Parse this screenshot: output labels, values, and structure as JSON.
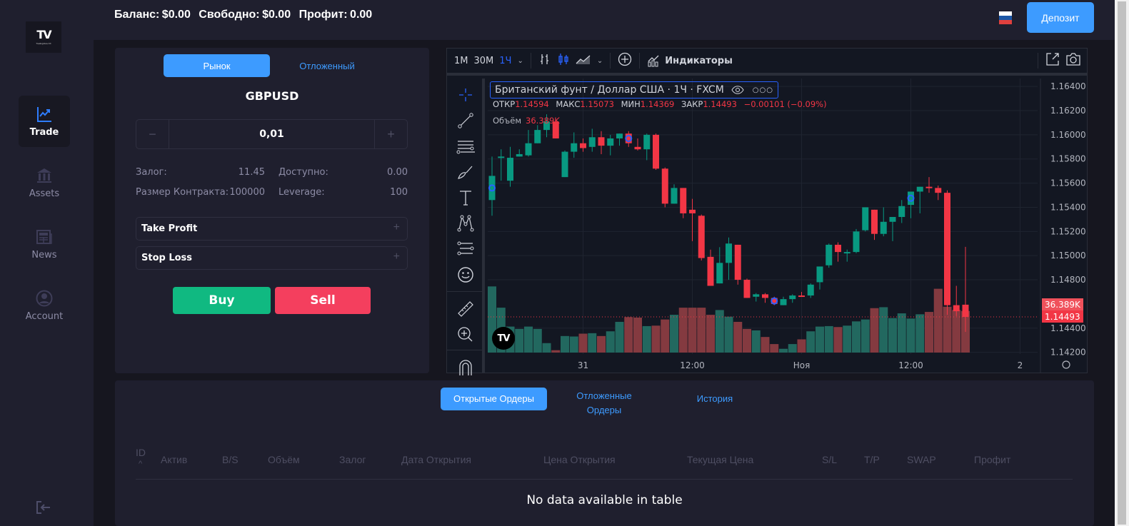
{
  "header": {
    "balance_label": "Баланс: $0.00",
    "free_label": "Свободно: $0.00",
    "profit_label": "Профит: 0.00",
    "language_flag": "russia-flag",
    "deposit_label": "Депозит"
  },
  "sidebar": {
    "logo_text": "TV",
    "logo_sub": "TradingView FX",
    "items": [
      {
        "label": "Trade",
        "icon": "chart-line-icon",
        "active": true
      },
      {
        "label": "Assets",
        "icon": "bank-icon",
        "active": false
      },
      {
        "label": "News",
        "icon": "newspaper-icon",
        "active": false
      },
      {
        "label": "Account",
        "icon": "user-circle-icon",
        "active": false
      }
    ],
    "logout_icon": "logout-icon"
  },
  "order_panel": {
    "tabs": [
      {
        "label": "Рынок",
        "active": true
      },
      {
        "label": "Отложенный",
        "active": false
      }
    ],
    "symbol": "GBPUSD",
    "volume": "0,01",
    "minus": "−",
    "plus": "+",
    "info": [
      {
        "label": "Залог:",
        "value": "11.45",
        "label2": "Доступно:",
        "value2": "0.00"
      },
      {
        "label": "Размер Контракта:",
        "value": "100000",
        "label2": "Leverage:",
        "value2": "100"
      }
    ],
    "take_profit": "Take Profit",
    "stop_loss": "Stop Loss",
    "buy_label": "Buy",
    "sell_label": "Sell"
  },
  "chart": {
    "toolbar": {
      "intervals": [
        "1M",
        "30M",
        "1Ч"
      ],
      "active_interval": "1Ч",
      "indicators_label": "Индикаторы"
    },
    "legend": {
      "title": "Британский фунт / Доллар США · 1Ч · FXCM",
      "open_label": "ОТКР",
      "open": "1.14594",
      "high_label": "МАКС",
      "high": "1.15073",
      "low_label": "МИН",
      "low": "1.14369",
      "close_label": "ЗАКР",
      "close": "1.14493",
      "change": "−0.00101 (−0.09%)",
      "volume_label": "Объём",
      "volume": "36.389K"
    },
    "price_badge": "1.14493",
    "volume_badge": "36.389K",
    "colors": {
      "up": "#089981",
      "down": "#f23645",
      "up_vol": "#22685f",
      "down_vol": "#843a40",
      "accent": "#2962ff"
    }
  },
  "chart_data": {
    "type": "candlestick",
    "title": "Британский фунт / Доллар США · 1Ч · FXCM",
    "y_ticks": [
      "1.16400",
      "1.16200",
      "1.16000",
      "1.15800",
      "1.15600",
      "1.15400",
      "1.15200",
      "1.15000",
      "1.14800",
      "1.14400",
      "1.14200"
    ],
    "ylim": [
      1.1418,
      1.1646
    ],
    "x_ticks": [
      {
        "label": "31",
        "index": 10
      },
      {
        "label": "12:00",
        "index": 22
      },
      {
        "label": "Ноя",
        "index": 34
      },
      {
        "label": "12:00",
        "index": 46
      },
      {
        "label": "2",
        "index": 58
      }
    ],
    "candles": [
      [
        1.1546,
        1.1582,
        1.1533,
        1.1566,
        14.0
      ],
      [
        1.1582,
        1.1588,
        1.1562,
        1.1582,
        9.5
      ],
      [
        1.1562,
        1.159,
        1.1557,
        1.1581,
        5.5
      ],
      [
        1.1582,
        1.1588,
        1.1582,
        1.1584,
        5.0
      ],
      [
        1.1583,
        1.1604,
        1.1582,
        1.1593,
        5.5
      ],
      [
        1.1593,
        1.1608,
        1.1593,
        1.1604,
        5.0
      ],
      [
        1.1604,
        1.1617,
        1.1598,
        1.1611,
        2.0
      ],
      [
        1.1611,
        1.1612,
        1.1597,
        1.1597,
        0.5
      ],
      [
        1.1565,
        1.1587,
        1.1565,
        1.1586,
        3.5
      ],
      [
        1.1586,
        1.1602,
        1.1581,
        1.1593,
        3.4
      ],
      [
        1.1593,
        1.1597,
        1.1586,
        1.1589,
        4.0
      ],
      [
        1.159,
        1.1605,
        1.1586,
        1.1598,
        4.1
      ],
      [
        1.1598,
        1.1603,
        1.1584,
        1.1591,
        3.5
      ],
      [
        1.1591,
        1.16,
        1.1583,
        1.1597,
        4.5
      ],
      [
        1.1597,
        1.1601,
        1.1591,
        1.1601,
        6.5
      ],
      [
        1.1601,
        1.1603,
        1.159,
        1.1593,
        7.5
      ],
      [
        1.159,
        1.1597,
        1.1587,
        1.1588,
        7.4
      ],
      [
        1.1588,
        1.1601,
        1.1579,
        1.16,
        5.6
      ],
      [
        1.16,
        1.1601,
        1.1571,
        1.1572,
        5.7
      ],
      [
        1.1572,
        1.1573,
        1.154,
        1.1543,
        7.0
      ],
      [
        1.1543,
        1.1559,
        1.1543,
        1.1556,
        8.0
      ],
      [
        1.1556,
        1.1556,
        1.1531,
        1.1535,
        9.5
      ],
      [
        1.1538,
        1.1547,
        1.1512,
        1.1535,
        9.5
      ],
      [
        1.1533,
        1.1534,
        1.1496,
        1.1498,
        9.5
      ],
      [
        1.1499,
        1.1505,
        1.1476,
        1.1475,
        8.0
      ],
      [
        1.1477,
        1.1507,
        1.1477,
        1.1494,
        9.0
      ],
      [
        1.1494,
        1.1515,
        1.148,
        1.151,
        7.6
      ],
      [
        1.1509,
        1.1509,
        1.1476,
        1.148,
        6.5
      ],
      [
        1.148,
        1.1481,
        1.1465,
        1.1465,
        5.0
      ],
      [
        1.1466,
        1.1469,
        1.1462,
        1.1468,
        4.7
      ],
      [
        1.1468,
        1.1469,
        1.1461,
        1.1465,
        3.3
      ],
      [
        1.1465,
        1.1466,
        1.1459,
        1.146,
        1.8
      ],
      [
        1.1459,
        1.1466,
        1.1459,
        1.1464,
        0.8
      ],
      [
        1.1464,
        1.1468,
        1.1461,
        1.1467,
        1.8
      ],
      [
        1.1467,
        1.147,
        1.1466,
        1.1466,
        2.8
      ],
      [
        1.1467,
        1.1477,
        1.1465,
        1.1476,
        4.5
      ],
      [
        1.1478,
        1.149,
        1.1472,
        1.1491,
        5.5
      ],
      [
        1.1492,
        1.151,
        1.149,
        1.1509,
        5.6
      ],
      [
        1.1509,
        1.1511,
        1.1495,
        1.1503,
        5.4
      ],
      [
        1.1503,
        1.1505,
        1.1495,
        1.1503,
        5.7
      ],
      [
        1.1503,
        1.1522,
        1.1502,
        1.152,
        6.6
      ],
      [
        1.1521,
        1.154,
        1.152,
        1.154,
        7.0
      ],
      [
        1.1538,
        1.1538,
        1.1513,
        1.1518,
        9.4
      ],
      [
        1.1518,
        1.154,
        1.1516,
        1.1528,
        9.6
      ],
      [
        1.1528,
        1.1532,
        1.1512,
        1.1532,
        7.3
      ],
      [
        1.1532,
        1.1546,
        1.1527,
        1.1541,
        8.3
      ],
      [
        1.1542,
        1.1549,
        1.1531,
        1.1553,
        7.2
      ],
      [
        1.1553,
        1.1557,
        1.1535,
        1.1557,
        8.1
      ],
      [
        1.1557,
        1.1565,
        1.1552,
        1.1556,
        8.6
      ],
      [
        1.1556,
        1.1558,
        1.1546,
        1.1552,
        13.5
      ],
      [
        1.1552,
        1.1554,
        1.1451,
        1.1459,
        9.7
      ],
      [
        1.1459,
        1.1475,
        1.145,
        1.1454,
        9.0
      ],
      [
        1.14594,
        1.15073,
        1.14369,
        1.14493,
        8.8
      ]
    ],
    "candle_fields": [
      "open",
      "high",
      "low",
      "close",
      "volume_k"
    ],
    "last_price": 1.14493
  },
  "orders": {
    "tabs": [
      {
        "label": "Открытые Ордеры",
        "active": true
      },
      {
        "label": "Отложенные Ордеры",
        "active": false
      },
      {
        "label": "История",
        "active": false
      }
    ],
    "columns": [
      "ID",
      "Актив",
      "B/S",
      "Объём",
      "Залог",
      "Дата Открытия",
      "Цена Открытия",
      "Текущая Цена",
      "S/L",
      "T/P",
      "SWAP",
      "Профит"
    ],
    "empty_text": "No data available in table"
  }
}
